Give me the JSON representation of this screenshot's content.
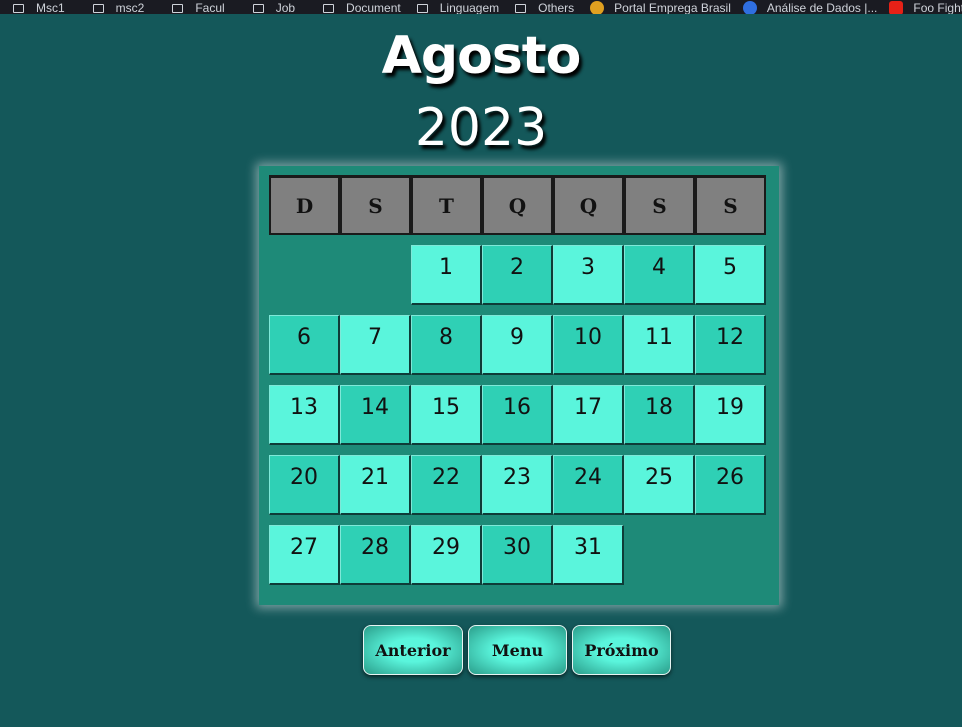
{
  "bookmarks": [
    {
      "label": "Msc1",
      "icon": "folder-icon"
    },
    {
      "label": "msc2",
      "icon": "folder-icon"
    },
    {
      "label": "Facul",
      "icon": "folder-icon"
    },
    {
      "label": "Job",
      "icon": "folder-icon"
    },
    {
      "label": "Document",
      "icon": "folder-icon"
    },
    {
      "label": "Linguagem",
      "icon": "folder-icon"
    },
    {
      "label": "Others",
      "icon": "folder-icon"
    },
    {
      "label": "Portal Emprega Brasil",
      "icon": "emprega-favicon",
      "color": "#e0a020"
    },
    {
      "label": "Análise de Dados |...",
      "icon": "analise-favicon",
      "color": "#2f6fe0"
    },
    {
      "label": "Foo Fighters - Best...",
      "icon": "youtube-icon",
      "color": "#e62117"
    }
  ],
  "calendar": {
    "month": "Agosto",
    "year": "2023",
    "weekdays": [
      "D",
      "S",
      "T",
      "Q",
      "Q",
      "S",
      "S"
    ],
    "weeks": [
      [
        "",
        "",
        "1",
        "2",
        "3",
        "4",
        "5"
      ],
      [
        "6",
        "7",
        "8",
        "9",
        "10",
        "11",
        "12"
      ],
      [
        "13",
        "14",
        "15",
        "16",
        "17",
        "18",
        "19"
      ],
      [
        "20",
        "21",
        "22",
        "23",
        "24",
        "25",
        "26"
      ],
      [
        "27",
        "28",
        "29",
        "30",
        "31",
        "",
        ""
      ]
    ]
  },
  "buttons": {
    "previous": "Anterior",
    "menu": "Menu",
    "next": "Próximo"
  },
  "colors": {
    "background": "#14585a",
    "panel": "#1e8a78",
    "day_light": "#5af5dc",
    "day_dark": "#2fd0b5",
    "header_cell": "#808080"
  }
}
